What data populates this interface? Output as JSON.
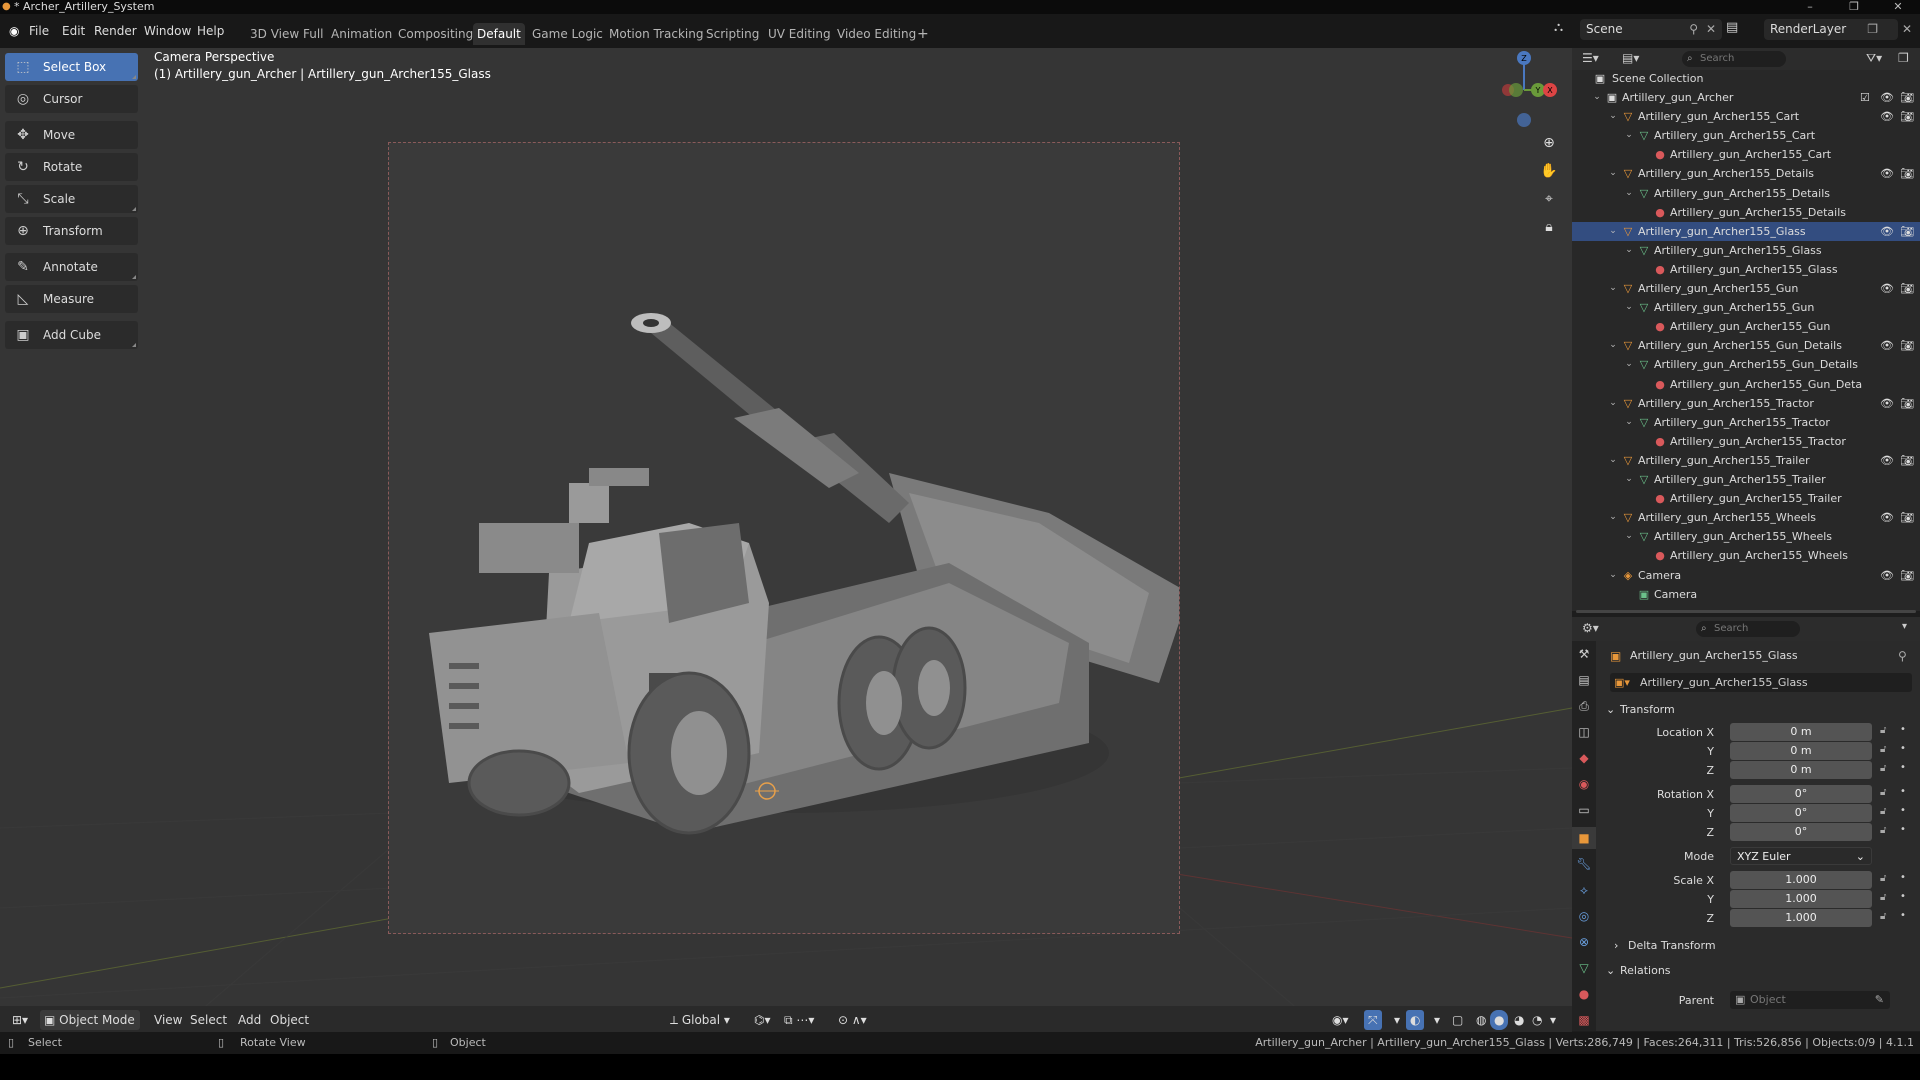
{
  "window": {
    "title": "* Archer_Artillery_System",
    "min": "–",
    "max": "❐",
    "close": "✕"
  },
  "menu": [
    "File",
    "Edit",
    "Render",
    "Window",
    "Help"
  ],
  "workspaces": [
    "3D View Full",
    "Animation",
    "Compositing",
    "Default",
    "Game Logic",
    "Motion Tracking",
    "Scripting",
    "UV Editing",
    "Video Editing",
    "+"
  ],
  "active_workspace": "Default",
  "scene": {
    "name": "Scene",
    "render_layer": "RenderLayer"
  },
  "tools": [
    {
      "label": "Select Box",
      "icon": "select-box-icon",
      "active": true
    },
    {
      "label": "Cursor",
      "icon": "cursor-icon"
    },
    {
      "label": "Move",
      "icon": "move-icon"
    },
    {
      "label": "Rotate",
      "icon": "rotate-icon"
    },
    {
      "label": "Scale",
      "icon": "scale-icon"
    },
    {
      "label": "Transform",
      "icon": "transform-icon"
    },
    {
      "label": "Annotate",
      "icon": "annotate-icon"
    },
    {
      "label": "Measure",
      "icon": "measure-icon"
    },
    {
      "label": "Add Cube",
      "icon": "add-cube-icon"
    }
  ],
  "viewport": {
    "perspective": "Camera Perspective",
    "object_info": "(1) Artillery_gun_Archer | Artillery_gun_Archer155_Glass",
    "gizmo": {
      "z": "Z",
      "y": "Y",
      "x": "X"
    }
  },
  "viewport_header": {
    "mode": "Object Mode",
    "menus": [
      "View",
      "Select",
      "Add",
      "Object"
    ],
    "orientation": "Global"
  },
  "outliner": {
    "search_placeholder": "Search",
    "root": "Scene Collection",
    "rows": [
      {
        "label": "Artillery_gun_Archer",
        "level": 0,
        "type": "collection",
        "check": true
      },
      {
        "label": "Artillery_gun_Archer155_Cart",
        "level": 1,
        "type": "object"
      },
      {
        "label": "Artillery_gun_Archer155_Cart",
        "level": 2,
        "type": "mesh"
      },
      {
        "label": "Artillery_gun_Archer155_Cart",
        "level": 3,
        "type": "material"
      },
      {
        "label": "Artillery_gun_Archer155_Details",
        "level": 1,
        "type": "object"
      },
      {
        "label": "Artillery_gun_Archer155_Details",
        "level": 2,
        "type": "mesh"
      },
      {
        "label": "Artillery_gun_Archer155_Details",
        "level": 3,
        "type": "material"
      },
      {
        "label": "Artillery_gun_Archer155_Glass",
        "level": 1,
        "type": "object",
        "selected": true
      },
      {
        "label": "Artillery_gun_Archer155_Glass",
        "level": 2,
        "type": "mesh"
      },
      {
        "label": "Artillery_gun_Archer155_Glass",
        "level": 3,
        "type": "material"
      },
      {
        "label": "Artillery_gun_Archer155_Gun",
        "level": 1,
        "type": "object"
      },
      {
        "label": "Artillery_gun_Archer155_Gun",
        "level": 2,
        "type": "mesh"
      },
      {
        "label": "Artillery_gun_Archer155_Gun",
        "level": 3,
        "type": "material"
      },
      {
        "label": "Artillery_gun_Archer155_Gun_Details",
        "level": 1,
        "type": "object"
      },
      {
        "label": "Artillery_gun_Archer155_Gun_Details",
        "level": 2,
        "type": "mesh"
      },
      {
        "label": "Artillery_gun_Archer155_Gun_Deta",
        "level": 3,
        "type": "material"
      },
      {
        "label": "Artillery_gun_Archer155_Tractor",
        "level": 1,
        "type": "object"
      },
      {
        "label": "Artillery_gun_Archer155_Tractor",
        "level": 2,
        "type": "mesh"
      },
      {
        "label": "Artillery_gun_Archer155_Tractor",
        "level": 3,
        "type": "material"
      },
      {
        "label": "Artillery_gun_Archer155_Trailer",
        "level": 1,
        "type": "object"
      },
      {
        "label": "Artillery_gun_Archer155_Trailer",
        "level": 2,
        "type": "mesh"
      },
      {
        "label": "Artillery_gun_Archer155_Trailer",
        "level": 3,
        "type": "material"
      },
      {
        "label": "Artillery_gun_Archer155_Wheels",
        "level": 1,
        "type": "object"
      },
      {
        "label": "Artillery_gun_Archer155_Wheels",
        "level": 2,
        "type": "mesh"
      },
      {
        "label": "Artillery_gun_Archer155_Wheels",
        "level": 3,
        "type": "material"
      },
      {
        "label": "Camera",
        "level": 1,
        "type": "camera"
      },
      {
        "label": "Camera",
        "level": 2,
        "type": "camera-data"
      }
    ]
  },
  "properties": {
    "search_placeholder": "Search",
    "object_name": "Artillery_gun_Archer155_Glass",
    "object_field": "Artillery_gun_Archer155_Glass",
    "transform_label": "Transform",
    "location_label": "Location X",
    "rotation_label": "Rotation X",
    "scale_label": "Scale X",
    "y_label": "Y",
    "z_label": "Z",
    "location": [
      "0 m",
      "0 m",
      "0 m"
    ],
    "rotation": [
      "0°",
      "0°",
      "0°"
    ],
    "mode_label": "Mode",
    "mode_value": "XYZ Euler",
    "scale": [
      "1.000",
      "1.000",
      "1.000"
    ],
    "delta_label": "Delta Transform",
    "relations_label": "Relations",
    "parent_label": "Parent",
    "parent_placeholder": "Object"
  },
  "statusbar": {
    "select": "Select",
    "rotate": "Rotate View",
    "object": "Object",
    "stats": "Artillery_gun_Archer | Artillery_gun_Archer155_Glass | Verts:286,749 | Faces:264,311 | Tris:526,856 | Objects:0/9 | 4.1.1"
  },
  "colors": {
    "accent": "#4772b3",
    "object_icon": "#e8973a",
    "mesh_icon": "#6bc18a",
    "material_icon": "#d9595b"
  }
}
